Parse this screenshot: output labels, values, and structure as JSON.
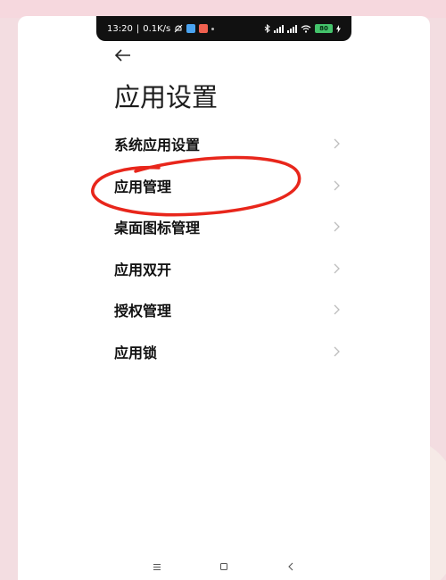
{
  "status_bar": {
    "time": "13:20",
    "network_speed": "0.1K/s",
    "icons_left": [
      "mute-icon",
      "app-icon-blue",
      "app-icon-red"
    ],
    "icons_right": [
      "bluetooth-icon",
      "signal-icon",
      "signal-icon",
      "wifi-icon",
      "battery-icon"
    ],
    "battery_level": "80"
  },
  "header": {
    "back_icon": "arrow-left-icon",
    "title": "应用设置"
  },
  "menu": {
    "items": [
      {
        "label": "系统应用设置"
      },
      {
        "label": "应用管理"
      },
      {
        "label": "桌面图标管理"
      },
      {
        "label": "应用双开"
      },
      {
        "label": "授权管理"
      },
      {
        "label": "应用锁"
      }
    ],
    "chevron_icon": "chevron-right-icon"
  },
  "annotation": {
    "color": "#e8261b",
    "highlighted_item": "应用管理"
  },
  "nav_bar": {
    "buttons": [
      "menu-icon",
      "home-icon",
      "back-icon"
    ]
  },
  "colors": {
    "text": "#111111",
    "chevron": "#bdbdbd",
    "background": "#ffffff"
  }
}
